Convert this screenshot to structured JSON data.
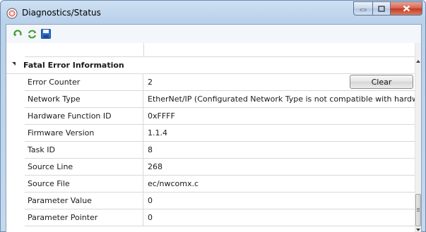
{
  "window": {
    "title": "Diagnostics/Status"
  },
  "toolbar": {
    "buttons": [
      "refresh-icon",
      "sync-icon",
      "save-icon"
    ]
  },
  "group": {
    "title": "Fatal Error Information"
  },
  "rows": [
    {
      "name": "Error Counter",
      "value": "2",
      "button": "Clear"
    },
    {
      "name": "Network Type",
      "value": "EtherNet/IP (Configurated Network Type is not compatible with hardware)"
    },
    {
      "name": "Hardware Function ID",
      "value": "0xFFFF"
    },
    {
      "name": "Firmware Version",
      "value": "1.1.4"
    },
    {
      "name": "Task ID",
      "value": "8"
    },
    {
      "name": "Source Line",
      "value": "268"
    },
    {
      "name": "Source File",
      "value": "ec/nwcomx.c"
    },
    {
      "name": "Parameter Value",
      "value": "0"
    },
    {
      "name": "Parameter Pointer",
      "value": "0"
    }
  ],
  "colors": {
    "title_bar": "#c4d8ee",
    "close_button": "#c43a22",
    "grid_line": "#d8d8d8"
  }
}
